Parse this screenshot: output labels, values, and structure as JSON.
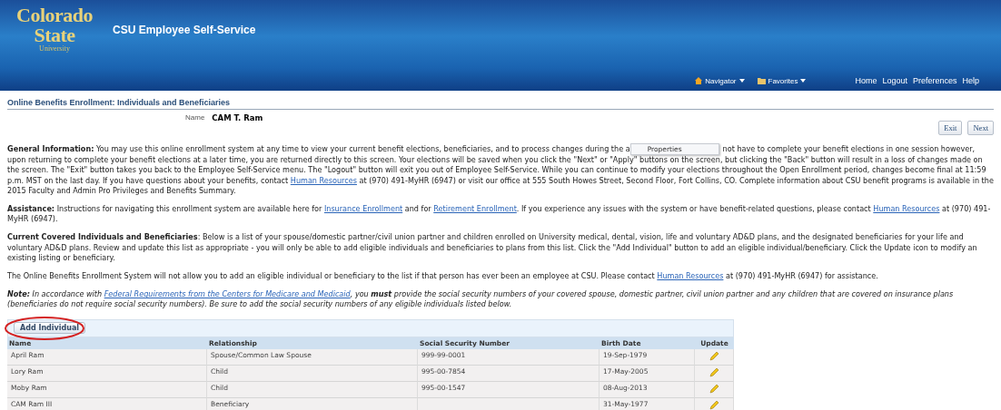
{
  "header": {
    "logo": [
      "Colorado",
      "State",
      "University"
    ],
    "title": "CSU Employee Self-Service",
    "menus": [
      {
        "label": "Navigator",
        "kind": "home"
      },
      {
        "label": "Favorites",
        "kind": "folder"
      }
    ],
    "links": [
      "Home",
      "Logout",
      "Preferences",
      "Help"
    ]
  },
  "page": {
    "title": "Online Benefits Enrollment: Individuals and Beneficiaries",
    "name_label": "Name",
    "name_value": "CAM T. Ram",
    "buttons": [
      "Exit",
      "Next"
    ]
  },
  "tooltip": {
    "text": "Properties"
  },
  "paragraphs": [
    {
      "kind": "plain",
      "segments": [
        {
          "text": "**General Information:** You may use this online enrollment system at any time to view your current benefit elections, beneficiaries, and to process changes during the a"
        },
        {
          "kind": "tooltip"
        },
        {
          "text": "not have to complete your benefit elections in one session however, upon returning to complete your benefit elections at a later time, you are returned directly to this screen. Your elections will be saved when you click the \"Next\" or \"Apply\" buttons on the screen, but clicking the \"Back\" button will result in a loss of changes made on the screen. The \"Exit\" button takes you back to the Employee Self-Service menu. The \"Logout\" button will exit you out of Employee Self-Service. While you can continue to modify your elections throughout the Open Enrollment period, changes become final at 11:59 p.m. MST on the last day. If you have questions about your benefits, contact "
        },
        {
          "link": "Human Resources"
        },
        {
          "text": " at (970) 491-MyHR (6947) or visit our office at 555 South Howes Street, Second Floor, Fort Collins, CO. Complete information about CSU benefit programs is available in the 2015 Faculty and Admin Pro Privileges and Benefits Summary."
        }
      ]
    },
    {
      "kind": "plain",
      "segments": [
        {
          "text": "**Assistance:** Instructions for navigating this enrollment system are available here for "
        },
        {
          "link": "Insurance Enrollment"
        },
        {
          "text": " and for "
        },
        {
          "link": "Retirement Enrollment"
        },
        {
          "text": ". If you experience any issues with the system or have benefit-related questions, please contact "
        },
        {
          "link": "Human Resources"
        },
        {
          "text": " at (970) 491-MyHR (6947)."
        }
      ]
    },
    {
      "kind": "plain",
      "segments": [
        {
          "text": "**Current Covered Individuals and Beneficiaries**: Below is a list of your spouse/domestic partner/civil union partner and children enrolled on University medical, dental, vision, life and voluntary AD&D plans, and the designated beneficiaries for your life and voluntary AD&D plans. Review and update this list as appropriate - you will only be able to add eligible individuals and beneficiaries to plans from this list. Click the \"Add Individual\" button to add an eligible individual/beneficiary. Click the Update icon to modify an existing listing or beneficiary."
        }
      ]
    },
    {
      "kind": "plain",
      "segments": [
        {
          "text": "The Online Benefits Enrollment System will not allow you to add an eligible individual or beneficiary to the list if that person has ever been an employee at CSU. Please contact "
        },
        {
          "link": "Human Resources"
        },
        {
          "text": " at (970) 491-MyHR (6947) for assistance."
        }
      ]
    },
    {
      "kind": "italic",
      "segments": [
        {
          "text": "**Note:** In accordance with "
        },
        {
          "link": "Federal Requirements from the Centers for Medicare and Medicaid"
        },
        {
          "text": ", you **must** provide the social security numbers of your covered spouse, domestic partner, civil union partner and any children that are covered on insurance plans (beneficiaries do not require social security numbers). Be sure to add the social security numbers of any eligible individuals listed below."
        }
      ]
    }
  ],
  "table": {
    "add_button": "Add Individual",
    "add_highlighted": true,
    "columns": [
      "Name",
      "Relationship",
      "Social Security Number",
      "Birth Date",
      "Update"
    ],
    "rows": [
      {
        "name": "April Ram",
        "relationship": "Spouse/Common Law Spouse",
        "ssn": "999-99-0001",
        "birth_date": "19-Sep-1979"
      },
      {
        "name": "Lory Ram",
        "relationship": "Child",
        "ssn": "995-00-7854",
        "birth_date": "17-May-2005"
      },
      {
        "name": "Moby Ram",
        "relationship": "Child",
        "ssn": "995-00-1547",
        "birth_date": "08-Aug-2013"
      },
      {
        "name": "CAM Ram III",
        "relationship": "Beneficiary",
        "birth_date": "31-May-1977"
      }
    ]
  }
}
